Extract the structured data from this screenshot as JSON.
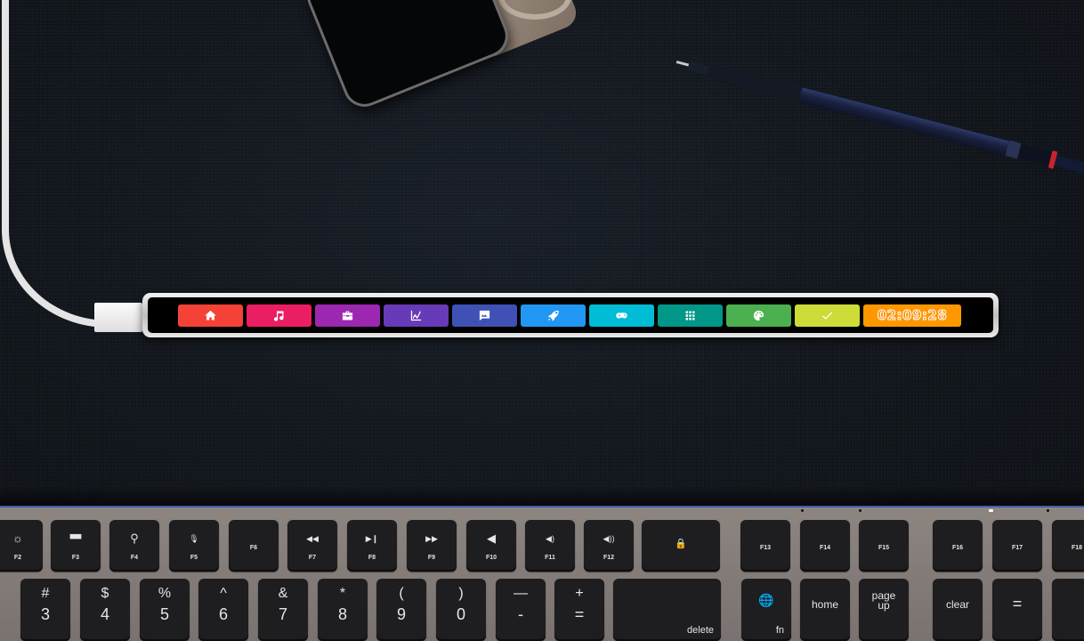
{
  "scene": "Desk with external touch bar display above a keyboard",
  "touchbar": {
    "buttons": [
      {
        "name": "home",
        "icon": "home-icon",
        "color": "#f44336"
      },
      {
        "name": "music",
        "icon": "music-note-icon",
        "color": "#e91e63"
      },
      {
        "name": "toolbox",
        "icon": "toolbox-icon",
        "color": "#9c27b0"
      },
      {
        "name": "chart",
        "icon": "line-chart-icon",
        "color": "#673ab7"
      },
      {
        "name": "image-message",
        "icon": "image-comment-icon",
        "color": "#3f51b5"
      },
      {
        "name": "rocket",
        "icon": "rocket-icon",
        "color": "#2196f3"
      },
      {
        "name": "gamepad",
        "icon": "gamepad-icon",
        "color": "#00bcd4"
      },
      {
        "name": "apps-grid",
        "icon": "grid-icon",
        "color": "#009688"
      },
      {
        "name": "palette",
        "icon": "palette-icon",
        "color": "#4caf50"
      },
      {
        "name": "check",
        "icon": "check-icon",
        "color": "#cddc39"
      }
    ],
    "clock": {
      "value": "02:09:28",
      "color": "#ff9800"
    }
  },
  "keyboard": {
    "fn_row": [
      {
        "label": "F2",
        "icon": "brightness-icon",
        "glyph": "☼"
      },
      {
        "label": "F3",
        "icon": "mission-control-icon",
        "glyph": "▀▀"
      },
      {
        "label": "F4",
        "icon": "search-icon",
        "glyph": "⚲"
      },
      {
        "label": "F5",
        "icon": "microphone-icon",
        "glyph": "🎙"
      },
      {
        "label": "F6",
        "icon": "",
        "glyph": ""
      },
      {
        "label": "F7",
        "icon": "rewind-icon",
        "glyph": "◀◀"
      },
      {
        "label": "F8",
        "icon": "play-pause-icon",
        "glyph": "▶❙"
      },
      {
        "label": "F9",
        "icon": "fast-forward-icon",
        "glyph": "▶▶"
      },
      {
        "label": "F10",
        "icon": "mute-icon",
        "glyph": "◀"
      },
      {
        "label": "F11",
        "icon": "volume-down-icon",
        "glyph": "◀)"
      },
      {
        "label": "F12",
        "icon": "volume-up-icon",
        "glyph": "◀))"
      },
      {
        "label": "",
        "icon": "lock-icon",
        "glyph": "🔒"
      },
      {
        "label": "F13",
        "icon": "",
        "glyph": ""
      },
      {
        "label": "F14",
        "icon": "",
        "glyph": ""
      },
      {
        "label": "F15",
        "icon": "",
        "glyph": ""
      },
      {
        "label": "F16",
        "icon": "",
        "glyph": ""
      },
      {
        "label": "F17",
        "icon": "",
        "glyph": ""
      },
      {
        "label": "F18",
        "icon": "",
        "glyph": ""
      }
    ],
    "num_row": [
      {
        "sym": "#",
        "num": "3"
      },
      {
        "sym": "$",
        "num": "4"
      },
      {
        "sym": "%",
        "num": "5"
      },
      {
        "sym": "^",
        "num": "6"
      },
      {
        "sym": "&",
        "num": "7"
      },
      {
        "sym": "*",
        "num": "8"
      },
      {
        "sym": "(",
        "num": "9"
      },
      {
        "sym": ")",
        "num": "0"
      },
      {
        "sym": "—",
        "num": "-"
      },
      {
        "sym": "+",
        "num": "="
      }
    ],
    "delete_label": "delete",
    "fn_label": "fn",
    "globe_glyph": "🌐",
    "home_label": "home",
    "page_up_label": "page\nup",
    "clear_label": "clear",
    "equals_label": "="
  }
}
